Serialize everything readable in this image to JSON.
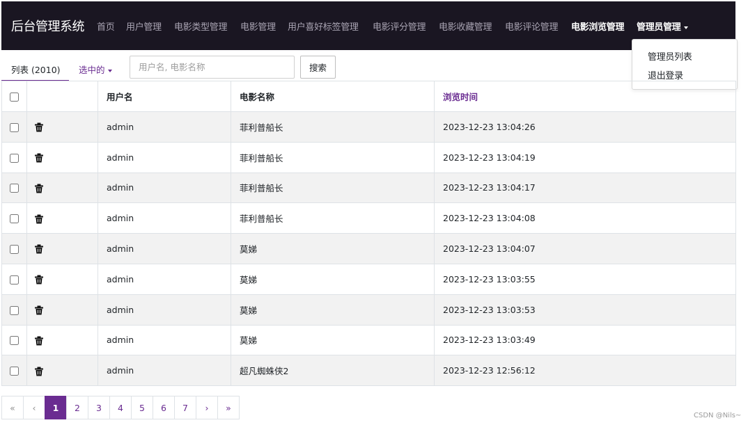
{
  "navbar": {
    "brand": "后台管理系统",
    "links": [
      "首页",
      "用户管理",
      "电影类型管理",
      "电影管理",
      "用户喜好标签管理",
      "电影评分管理",
      "电影收藏管理",
      "电影评论管理",
      "电影浏览管理",
      "管理员管理"
    ],
    "active_link": "电影浏览管理"
  },
  "dropdown": {
    "items": [
      "管理员列表",
      "退出登录"
    ]
  },
  "toolbar": {
    "tab_label": "列表 (2010)",
    "selected_label": "选中的",
    "search_placeholder": "用户名, 电影名称",
    "search_value": "",
    "search_button": "搜索"
  },
  "table": {
    "columns": [
      "",
      "",
      "用户名",
      "电影名称",
      "浏览时间"
    ],
    "sorted_column": "浏览时间",
    "rows": [
      {
        "username": "admin",
        "movie": "菲利普船长",
        "time": "2023-12-23 13:04:26"
      },
      {
        "username": "admin",
        "movie": "菲利普船长",
        "time": "2023-12-23 13:04:19"
      },
      {
        "username": "admin",
        "movie": "菲利普船长",
        "time": "2023-12-23 13:04:17"
      },
      {
        "username": "admin",
        "movie": "菲利普船长",
        "time": "2023-12-23 13:04:08"
      },
      {
        "username": "admin",
        "movie": "莫娣",
        "time": "2023-12-23 13:04:07"
      },
      {
        "username": "admin",
        "movie": "莫娣",
        "time": "2023-12-23 13:03:55"
      },
      {
        "username": "admin",
        "movie": "莫娣",
        "time": "2023-12-23 13:03:53"
      },
      {
        "username": "admin",
        "movie": "莫娣",
        "time": "2023-12-23 13:03:49"
      },
      {
        "username": "admin",
        "movie": "超凡蜘蛛侠2",
        "time": "2023-12-23 12:56:12"
      }
    ],
    "row_action_icon": "trash-icon"
  },
  "pagination": {
    "first": "«",
    "prev": "‹",
    "pages": [
      "1",
      "2",
      "3",
      "4",
      "5",
      "6",
      "7"
    ],
    "current": "1",
    "next": "›",
    "last": "»"
  },
  "watermark": "CSDN @Nils~",
  "colors": {
    "navbar_bg": "#1a1622",
    "accent": "#6a2c91",
    "stripe": "#f2f2f2"
  }
}
